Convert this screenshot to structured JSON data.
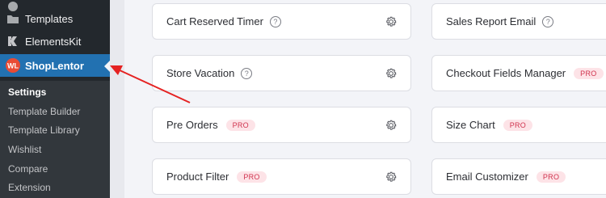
{
  "sidebar": {
    "templates_label": "Templates",
    "elementskit_label": "ElementsKit",
    "shoplentor_label": "ShopLentor",
    "submenu": [
      "Settings",
      "Template Builder",
      "Template Library",
      "Wishlist",
      "Compare",
      "Extension"
    ]
  },
  "modules_left": [
    {
      "title": "Cart Reserved Timer",
      "badge": ""
    },
    {
      "title": "Store Vacation",
      "badge": ""
    },
    {
      "title": "Pre Orders",
      "badge": "PRO"
    },
    {
      "title": "Product Filter",
      "badge": "PRO"
    }
  ],
  "modules_right": [
    {
      "title": "Sales Report Email",
      "badge": ""
    },
    {
      "title": "Checkout Fields Manager",
      "badge": "PRO"
    },
    {
      "title": "Size Chart",
      "badge": "PRO"
    },
    {
      "title": "Email Customizer",
      "badge": "PRO"
    }
  ],
  "help_glyph": "?",
  "colors": {
    "accent": "#2271b1",
    "pro_bg": "#fde3e7",
    "pro_text": "#d0334e",
    "arrow": "#e52222",
    "shoplentor_logo": "#e94b35"
  }
}
